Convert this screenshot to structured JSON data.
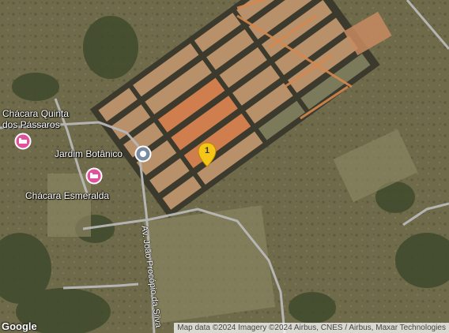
{
  "map": {
    "type": "satellite",
    "places": [
      {
        "name": "Chácara Quinta\ndos Pássaros",
        "kind": "lodging"
      },
      {
        "name": "Jardim Botânico",
        "kind": "point-of-interest"
      },
      {
        "name": "Chácara Esmeralda",
        "kind": "lodging"
      }
    ],
    "road": "Av. João Procópio da Silva",
    "marker": {
      "label": "1",
      "color": "#f5c518"
    },
    "logo": "Google",
    "attribution": "Map data ©2024 Imagery ©2024 Airbus, CNES / Airbus, Maxar Technologies"
  }
}
